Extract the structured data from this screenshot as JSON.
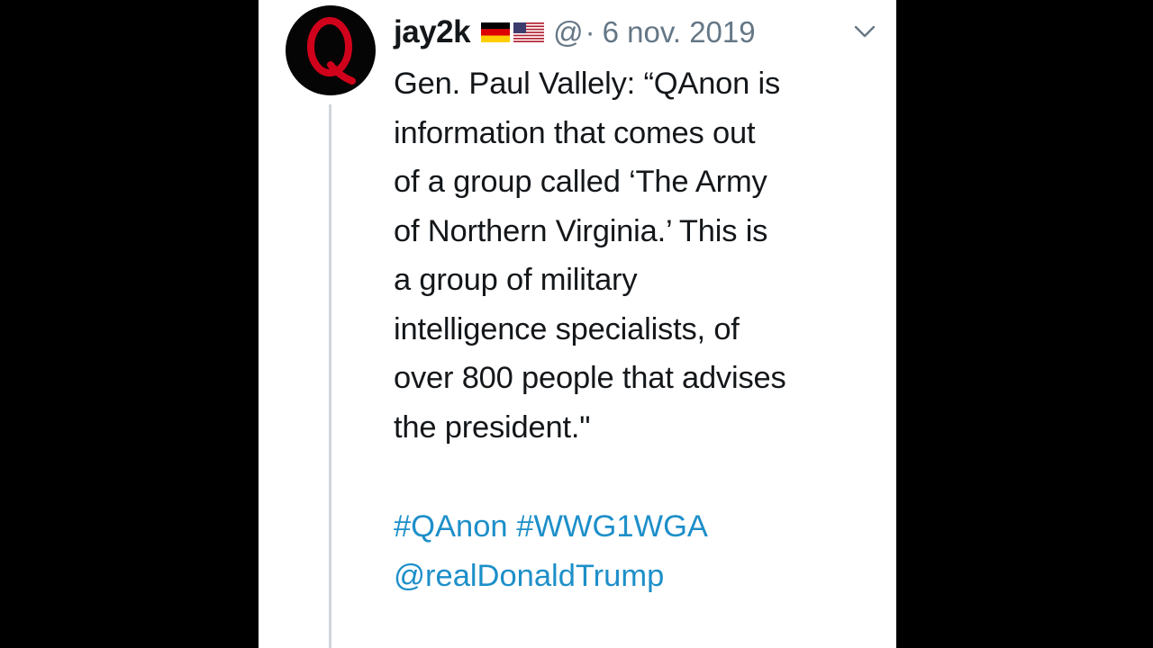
{
  "tweet": {
    "username": "jay2k",
    "flags": [
      "germany-flag-icon",
      "usa-flag-icon"
    ],
    "handle_partial": "@",
    "separator": "·",
    "date": "6 nov. 2019",
    "text": "Gen. Paul Vallely: “QAnon is\ninformation that comes out\nof a group called ‘The Army\nof Northern Virginia.’ This is\na group of military\nintelligence specialists, of\nover 800 people that advises\nthe president.\"",
    "hashtags": [
      "#QAnon",
      "#WWG1WGA"
    ],
    "mention": "@realDonaldTrump",
    "avatar_icon": "q-logo-avatar-icon",
    "menu_icon": "chevron-down-icon"
  },
  "colors": {
    "background": "#000000",
    "panel": "#ffffff",
    "text": "#14171a",
    "muted": "#657786",
    "link": "#1d8fc9",
    "avatar_q": "#d0021b"
  }
}
